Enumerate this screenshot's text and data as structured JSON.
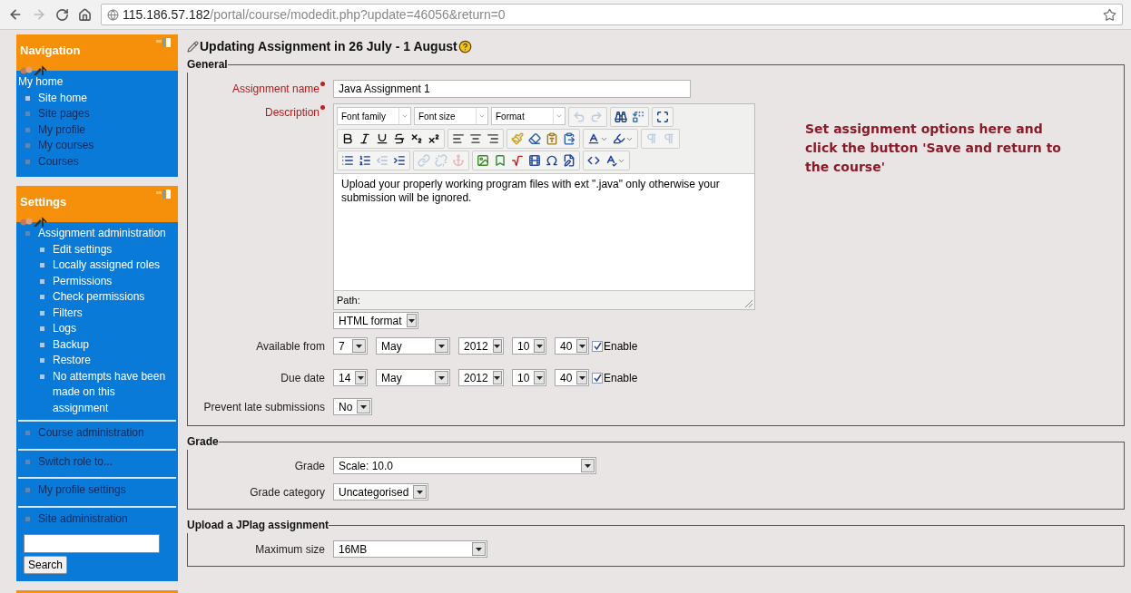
{
  "browser": {
    "url_host": "115.186.57.182",
    "url_path": "/portal/course/modedit.php?update=46056&return=0",
    "forward_disabled": true
  },
  "sidebar": {
    "blocks": [
      {
        "title": "Navigation",
        "items": [
          {
            "label": "My home",
            "kind": "plain",
            "children": [
              {
                "label": "Site home",
                "kind": "leaf"
              },
              {
                "label": "Site pages",
                "kind": "branch"
              },
              {
                "label": "My profile",
                "kind": "branch"
              },
              {
                "label": "My courses",
                "kind": "branch"
              },
              {
                "label": "Courses",
                "kind": "branch"
              }
            ]
          }
        ]
      },
      {
        "title": "Settings",
        "items": [
          {
            "label": "Assignment administration",
            "kind": "branch",
            "children": [
              {
                "label": "Edit settings",
                "kind": "leaf"
              },
              {
                "label": "Locally assigned roles",
                "kind": "leaf"
              },
              {
                "label": "Permissions",
                "kind": "leaf"
              },
              {
                "label": "Check permissions",
                "kind": "leaf"
              },
              {
                "label": "Filters",
                "kind": "leaf"
              },
              {
                "label": "Logs",
                "kind": "leaf"
              },
              {
                "label": "Backup",
                "kind": "leaf"
              },
              {
                "label": "Restore",
                "kind": "leaf"
              },
              {
                "label": "No attempts have been made on this assignment",
                "kind": "leaf"
              }
            ]
          },
          {
            "label": "Course administration",
            "kind": "branch"
          },
          {
            "label": "Switch role to...",
            "kind": "branch"
          },
          {
            "label": "My profile settings",
            "kind": "branch"
          },
          {
            "label": "Site administration",
            "kind": "branch"
          }
        ]
      }
    ],
    "search_button": "Search"
  },
  "page": {
    "title": "Updating Assignment in 26 July - 1 August",
    "note": "Set assignment options here and click the button 'Save and return to the course'",
    "sections": [
      {
        "legend": "General",
        "fields": [
          {
            "kind": "text",
            "label": "Assignment name",
            "required": true,
            "value": "Java Assignment 1"
          },
          {
            "kind": "editor",
            "label": "Description",
            "required": true,
            "toolbar": [
              {
                "selects": [
                  "Font family",
                  "Font size",
                  "Format"
                ],
                "groups": [
                  [
                    {
                      "kind": "undo",
                      "disabled": true
                    },
                    {
                      "kind": "redo",
                      "disabled": true
                    }
                  ],
                  [
                    {
                      "kind": "find",
                      "disabled": false
                    },
                    {
                      "kind": "replace",
                      "disabled": false
                    }
                  ],
                  [
                    {
                      "kind": "fullscreen",
                      "disabled": false
                    }
                  ]
                ]
              },
              {
                "groups": [
                  [
                    {
                      "kind": "bold",
                      "disabled": false
                    },
                    {
                      "kind": "italic",
                      "disabled": false
                    },
                    {
                      "kind": "underline",
                      "disabled": false
                    },
                    {
                      "kind": "strikethrough",
                      "disabled": false
                    },
                    {
                      "kind": "subscript",
                      "disabled": false
                    },
                    {
                      "kind": "superscript",
                      "disabled": false
                    }
                  ],
                  [
                    {
                      "kind": "align-left",
                      "disabled": false
                    },
                    {
                      "kind": "align-center",
                      "disabled": false
                    },
                    {
                      "kind": "align-right",
                      "disabled": false
                    }
                  ],
                  [
                    {
                      "kind": "cleanup",
                      "disabled": false
                    },
                    {
                      "kind": "eraser",
                      "disabled": false
                    },
                    {
                      "kind": "paste-text",
                      "disabled": false
                    },
                    {
                      "kind": "paste-word",
                      "disabled": false
                    }
                  ],
                  [
                    {
                      "kind": "text-color",
                      "disabled": false
                    },
                    {
                      "kind": "highlight",
                      "disabled": false
                    }
                  ],
                  [
                    {
                      "kind": "ltr",
                      "disabled": true
                    },
                    {
                      "kind": "rtl",
                      "disabled": true
                    }
                  ]
                ]
              },
              {
                "groups": [
                  [
                    {
                      "kind": "bullet-list",
                      "disabled": false
                    },
                    {
                      "kind": "numbered-list",
                      "disabled": false
                    },
                    {
                      "kind": "outdent",
                      "disabled": true
                    },
                    {
                      "kind": "indent",
                      "disabled": false
                    }
                  ],
                  [
                    {
                      "kind": "link",
                      "disabled": true
                    },
                    {
                      "kind": "unlink",
                      "disabled": true
                    },
                    {
                      "kind": "anchor",
                      "disabled": true
                    }
                  ],
                  [
                    {
                      "kind": "image",
                      "disabled": false
                    },
                    {
                      "kind": "bookmark",
                      "disabled": false
                    },
                    {
                      "kind": "formula",
                      "disabled": false
                    },
                    {
                      "kind": "media",
                      "disabled": false
                    },
                    {
                      "kind": "special-char",
                      "disabled": false
                    },
                    {
                      "kind": "edit",
                      "disabled": false
                    }
                  ],
                  [
                    {
                      "kind": "html",
                      "disabled": false
                    },
                    {
                      "kind": "spellcheck",
                      "disabled": false
                    }
                  ]
                ]
              }
            ],
            "content": "Upload your properly working program files with ext \".java\" only otherwise your submission will be ignored.",
            "path_label": "Path:",
            "format": "HTML format"
          },
          {
            "kind": "datetime",
            "label": "Available from",
            "required": false,
            "values": [
              "7",
              "May",
              "2012",
              "10",
              "40"
            ],
            "enable_label": "Enable",
            "enabled": true
          },
          {
            "kind": "datetime",
            "label": "Due date",
            "required": false,
            "values": [
              "14",
              "May",
              "2012",
              "10",
              "40"
            ],
            "enable_label": "Enable",
            "enabled": true
          },
          {
            "kind": "select",
            "label": "Prevent late submissions",
            "required": false,
            "value": "No"
          }
        ]
      },
      {
        "legend": "Grade",
        "fields": [
          {
            "kind": "wide-select",
            "label": "Grade",
            "required": false,
            "value": "Scale: 10.0"
          },
          {
            "kind": "select",
            "label": "Grade category",
            "required": false,
            "value": "Uncategorised"
          }
        ]
      },
      {
        "legend": "Upload a JPlag assignment",
        "fields": [
          {
            "kind": "medium-select",
            "label": "Maximum size",
            "required": false,
            "value": "16MB"
          }
        ]
      }
    ]
  }
}
